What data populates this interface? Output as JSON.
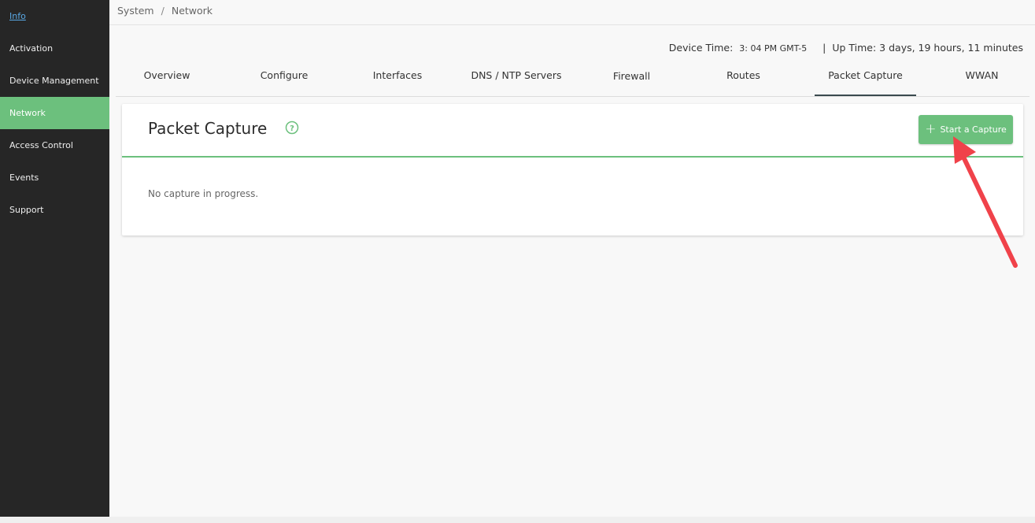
{
  "sidebar": {
    "items": [
      {
        "label": "Info"
      },
      {
        "label": "Activation"
      },
      {
        "label": "Device Management"
      },
      {
        "label": "Network"
      },
      {
        "label": "Access Control"
      },
      {
        "label": "Events"
      },
      {
        "label": "Support"
      }
    ],
    "active": "Network"
  },
  "breadcrumb": {
    "root": "System",
    "separator": "/",
    "current": "Network"
  },
  "status": {
    "device_time_label": "Device Time:",
    "device_time_value": "3: 04 PM GMT-5",
    "separator": "|",
    "up_time_label": "Up Time:",
    "up_time_value": "3 days, 19 hours, 11 minutes"
  },
  "tabs": [
    {
      "label": "Overview"
    },
    {
      "label": "Configure"
    },
    {
      "label": "Interfaces"
    },
    {
      "label": "DNS / NTP Servers"
    },
    {
      "label": "Firewall"
    },
    {
      "label": "Routes"
    },
    {
      "label": "Packet Capture"
    },
    {
      "label": "WWAN"
    }
  ],
  "active_tab": "Packet Capture",
  "card": {
    "title": "Packet Capture",
    "help_icon": "help-circle-icon",
    "start_button_label": "Start a Capture",
    "start_button_icon": "plus-icon",
    "empty_message": "No capture in progress."
  },
  "colors": {
    "accent": "#6cc07d",
    "sidebar_bg": "#262626",
    "annotation_arrow": "#f0424a"
  }
}
